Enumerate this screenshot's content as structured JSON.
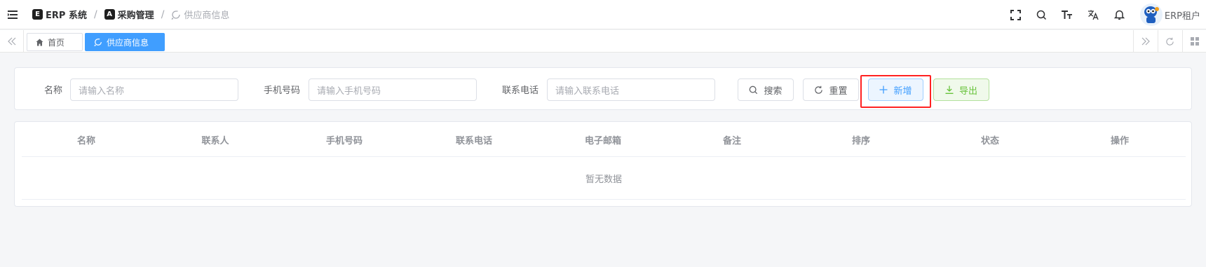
{
  "breadcrumb": {
    "items": [
      {
        "badge": "E",
        "label": "ERP 系统"
      },
      {
        "badge": "A",
        "label": "采购管理"
      },
      {
        "label": "供应商信息"
      }
    ],
    "separator": "/"
  },
  "header": {
    "icons": [
      "fullscreen-icon",
      "search-icon",
      "font-size-icon",
      "translate-icon",
      "bell-icon"
    ],
    "user_name": "ERP租户"
  },
  "tags": {
    "home_label": "首页",
    "active_label": "供应商信息"
  },
  "search_form": {
    "fields": [
      {
        "label": "名称",
        "placeholder": "请输入名称"
      },
      {
        "label": "手机号码",
        "placeholder": "请输入手机号码"
      },
      {
        "label": "联系电话",
        "placeholder": "请输入联系电话"
      }
    ],
    "buttons": {
      "search": "搜索",
      "reset": "重置",
      "add": "新增",
      "export": "导出"
    }
  },
  "table": {
    "columns": [
      "名称",
      "联系人",
      "手机号码",
      "联系电话",
      "电子邮箱",
      "备注",
      "排序",
      "状态",
      "操作"
    ],
    "empty_text": "暂无数据"
  },
  "colors": {
    "primary": "#409eff",
    "success": "#67c23a",
    "highlight": "#ff2222"
  }
}
